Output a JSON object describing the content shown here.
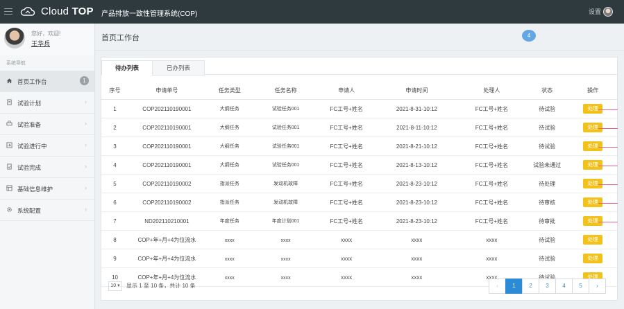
{
  "header": {
    "brand_light": "Cloud ",
    "brand_bold": "TOP",
    "system_title": "产品排放一致性管理系统(COP)",
    "settings_label": "设置"
  },
  "sidebar": {
    "greeting": "您好，欢迎!",
    "username": "王华兵",
    "nav_title": "系统导航",
    "items": [
      {
        "label": "首页工作台",
        "icon": "home-icon",
        "badge": "1"
      },
      {
        "label": "试验计划",
        "icon": "document-icon"
      },
      {
        "label": "试验准备",
        "icon": "print-icon"
      },
      {
        "label": "试验进行中",
        "icon": "progress-icon"
      },
      {
        "label": "试验完成",
        "icon": "check-document-icon"
      },
      {
        "label": "基础信息维护",
        "icon": "grid-icon"
      },
      {
        "label": "系统配置",
        "icon": "gear-icon"
      }
    ]
  },
  "main": {
    "page_title": "首页工作台",
    "notification_count": "4",
    "tabs": [
      "待办列表",
      "已办列表"
    ],
    "columns": [
      "序号",
      "申请单号",
      "任务类型",
      "任务名称",
      "申请人",
      "申请时间",
      "处理人",
      "状态",
      "操作"
    ],
    "rows": [
      [
        "1",
        "COP202110190001",
        "大纲任务",
        "试验任务001",
        "FC工号+姓名",
        "2021-8-31-10:12",
        "FC工号+姓名",
        "待试验",
        "处理"
      ],
      [
        "2",
        "COP202110190001",
        "大纲任务",
        "试验任务001",
        "FC工号+姓名",
        "2021-8-11-10:12",
        "FC工号+姓名",
        "待试验",
        "处理"
      ],
      [
        "3",
        "COP202110190001",
        "大纲任务",
        "试验任务001",
        "FC工号+姓名",
        "2021-8-21-10:12",
        "FC工号+姓名",
        "待试验",
        "处理"
      ],
      [
        "4",
        "COP202110190001",
        "大纲任务",
        "试验任务001",
        "FC工号+姓名",
        "2021-8-13-10:12",
        "FC工号+姓名",
        "试验未通过",
        "处理"
      ],
      [
        "5",
        "COP202110190002",
        "指派任务",
        "发动机故障",
        "FC工号+姓名",
        "2021-8-23-10:12",
        "FC工号+姓名",
        "待处理",
        "处理"
      ],
      [
        "6",
        "COP202110190002",
        "指派任务",
        "发动机故障",
        "FC工号+姓名",
        "2021-8-23-10:12",
        "FC工号+姓名",
        "待审核",
        "处理"
      ],
      [
        "7",
        "ND202110210001",
        "年度任务",
        "年度计划001",
        "FC工号+姓名",
        "2021-8-23-10:12",
        "FC工号+姓名",
        "待审批",
        "处理"
      ],
      [
        "8",
        "COP+年+月+4为位流水",
        "xxxx",
        "xxxx",
        "xxxx",
        "xxxx",
        "xxxx",
        "待试验",
        "处理"
      ],
      [
        "9",
        "COP+年+月+4为位流水",
        "xxxx",
        "xxxx",
        "xxxx",
        "xxxx",
        "xxxx",
        "待试验",
        "处理"
      ],
      [
        "10",
        "COP+年+月+4为位流水",
        "xxxx",
        "xxxx",
        "xxxx",
        "xxxx",
        "xxxx",
        "待试验",
        "处理"
      ]
    ],
    "page_size": "10",
    "record_info": "显示 1 至 10 条，共计 10 条",
    "pages": [
      "1",
      "2",
      "3",
      "4",
      "5"
    ]
  },
  "colors": {
    "topbar": "#2f3a3f",
    "action_button": "#f2c21b",
    "pager_active": "#2b8bd6",
    "badge_blue": "#64a7e4"
  }
}
